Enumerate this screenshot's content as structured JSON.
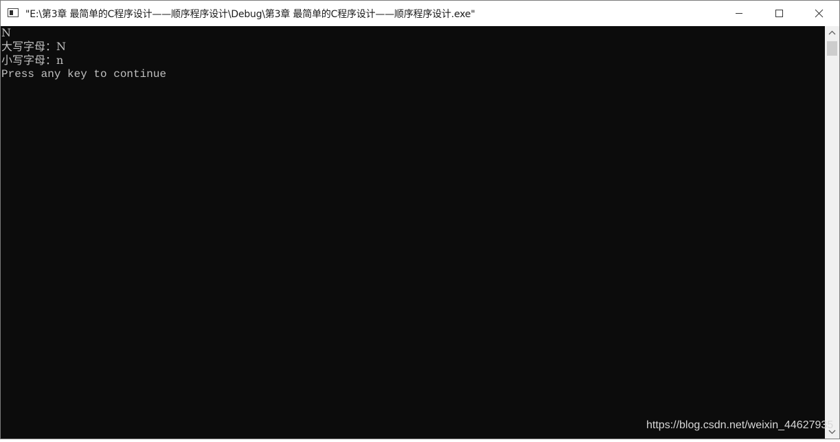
{
  "window": {
    "title": "\"E:\\第3章  最简单的C程序设计——顺序程序设计\\Debug\\第3章  最简单的C程序设计——顺序程序设计.exe\"",
    "icon": "console-app-icon",
    "controls": {
      "minimize": "minimize-icon",
      "maximize": "maximize-icon",
      "close": "close-icon"
    }
  },
  "console": {
    "background": "#0c0c0c",
    "foreground": "#c0c0c0",
    "lines": [
      "N",
      "大写字母：N",
      "小写字母：n",
      "Press any key to continue"
    ]
  },
  "scrollbar": {
    "up_icon": "chevron-up-icon",
    "down_icon": "chevron-down-icon"
  },
  "watermark": "https://blog.csdn.net/weixin_44627935"
}
